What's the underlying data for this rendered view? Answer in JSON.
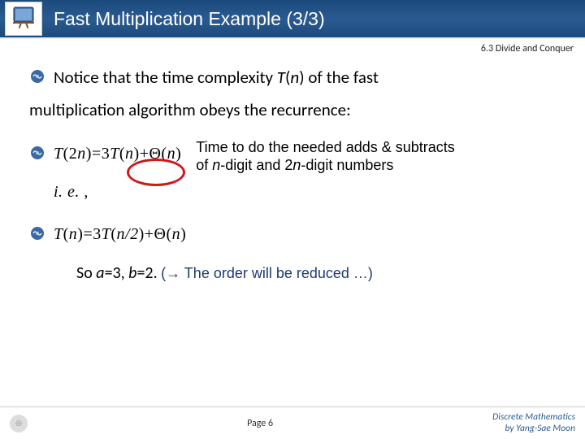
{
  "header": {
    "title": "Fast Multiplication Example (3/3)",
    "section": "6.3 Divide and Conquer"
  },
  "body": {
    "line1a": "Notice that the time complexity ",
    "line1_T": "T",
    "line1_paren_open": "(",
    "line1_n": "n",
    "line1_paren_close": ")",
    "line1b": " of the fast",
    "line2": "multiplication algorithm obeys the recurrence:",
    "formula1_a": "T",
    "formula1_b": "(2",
    "formula1_c": "n",
    "formula1_d": ")=3",
    "formula1_e": "T",
    "formula1_f": "(",
    "formula1_g": "n",
    "formula1_h": ")+Θ(",
    "formula1_i": "n",
    "formula1_j": ")",
    "annot1": "Time to do the needed adds & subtracts",
    "annot2a": "of ",
    "annot2_n1": "n",
    "annot2b": "-digit and 2",
    "annot2_n2": "n",
    "annot2c": "-digit numbers",
    "ie": "i. e. ,",
    "formula2_a": "T",
    "formula2_b": "(",
    "formula2_c": "n",
    "formula2_d": ")=3",
    "formula2_e": "T",
    "formula2_f": "(",
    "formula2_g": "n/2",
    "formula2_h": ")+Θ(",
    "formula2_i": "n",
    "formula2_j": ")",
    "so_a": "So ",
    "so_b": "a",
    "so_c": "=3, ",
    "so_d": "b",
    "so_e": "=2.  ",
    "reduced": "(→ The order will be reduced …)"
  },
  "footer": {
    "page": "Page 6",
    "credit1": "Discrete Mathematics",
    "credit2": "by Yang-Sae Moon"
  }
}
